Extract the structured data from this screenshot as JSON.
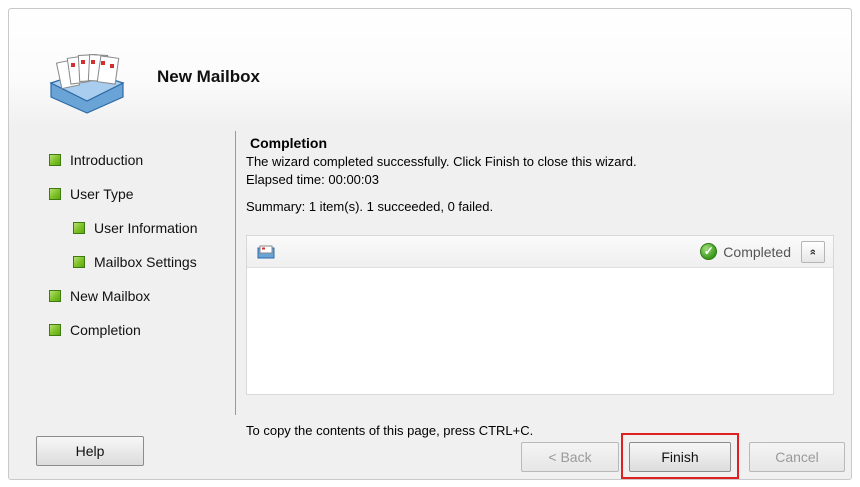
{
  "wizard": {
    "title": "New Mailbox"
  },
  "steps": [
    {
      "label": "Introduction",
      "indent": false
    },
    {
      "label": "User Type",
      "indent": false
    },
    {
      "label": "User Information",
      "indent": true
    },
    {
      "label": "Mailbox Settings",
      "indent": true
    },
    {
      "label": "New Mailbox",
      "indent": false
    },
    {
      "label": "Completion",
      "indent": false
    }
  ],
  "content": {
    "title": "Completion",
    "message": "The wizard completed successfully. Click Finish to close this wizard.",
    "elapsed": "Elapsed time: 00:00:03",
    "summary": "Summary: 1 item(s). 1 succeeded, 0 failed."
  },
  "results": {
    "status": "Completed",
    "collapse_glyph": "»"
  },
  "copy_hint": "To copy the contents of this page, press CTRL+C.",
  "buttons": {
    "help": "Help",
    "back": "< Back",
    "finish": "Finish",
    "cancel": "Cancel"
  },
  "colors": {
    "step_marker": "#7cc022",
    "highlight": "#e02020",
    "status_ok": "#3c9a1e"
  },
  "icons": {
    "wizard": "mailbox-icon",
    "item": "mailbox-item-icon",
    "status": "check-circle-icon",
    "collapse": "collapse-icon"
  }
}
